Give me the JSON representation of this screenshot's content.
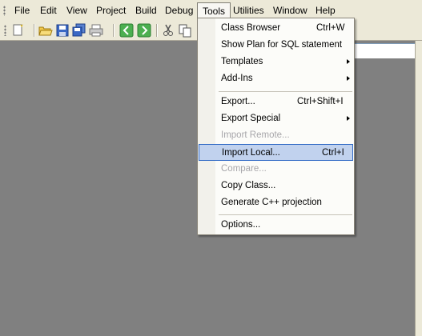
{
  "menubar": {
    "items": [
      {
        "label": "File"
      },
      {
        "label": "Edit"
      },
      {
        "label": "View"
      },
      {
        "label": "Project"
      },
      {
        "label": "Build"
      },
      {
        "label": "Debug"
      },
      {
        "label": "Tools"
      },
      {
        "label": "Utilities"
      },
      {
        "label": "Window"
      },
      {
        "label": "Help"
      }
    ]
  },
  "toolbar": {
    "buttons": [
      "new-file-icon",
      "open-folder-icon",
      "save-icon",
      "save-all-icon",
      "print-icon",
      "back-arrow-icon",
      "forward-arrow-icon",
      "cut-icon",
      "copy-icon"
    ]
  },
  "tools_menu": {
    "items": [
      {
        "label": "Class Browser",
        "shortcut": "Ctrl+W"
      },
      {
        "label": "Show Plan for SQL statement",
        "shortcut": ""
      },
      {
        "label": "Templates",
        "shortcut": ""
      },
      {
        "label": "Add-Ins",
        "shortcut": ""
      },
      {
        "label": "Export...",
        "shortcut": "Ctrl+Shift+I"
      },
      {
        "label": "Export Special",
        "shortcut": ""
      },
      {
        "label": "Import Remote...",
        "shortcut": ""
      },
      {
        "label": "Import Local...",
        "shortcut": "Ctrl+I"
      },
      {
        "label": "Compare...",
        "shortcut": ""
      },
      {
        "label": "Copy Class...",
        "shortcut": ""
      },
      {
        "label": "Generate C++ projection",
        "shortcut": ""
      },
      {
        "label": "Options...",
        "shortcut": ""
      }
    ]
  },
  "colors": {
    "menu_highlight": "#c1d2ee",
    "menu_highlight_border": "#316ac5",
    "workspace": "#808080",
    "chrome": "#ece9d8"
  }
}
